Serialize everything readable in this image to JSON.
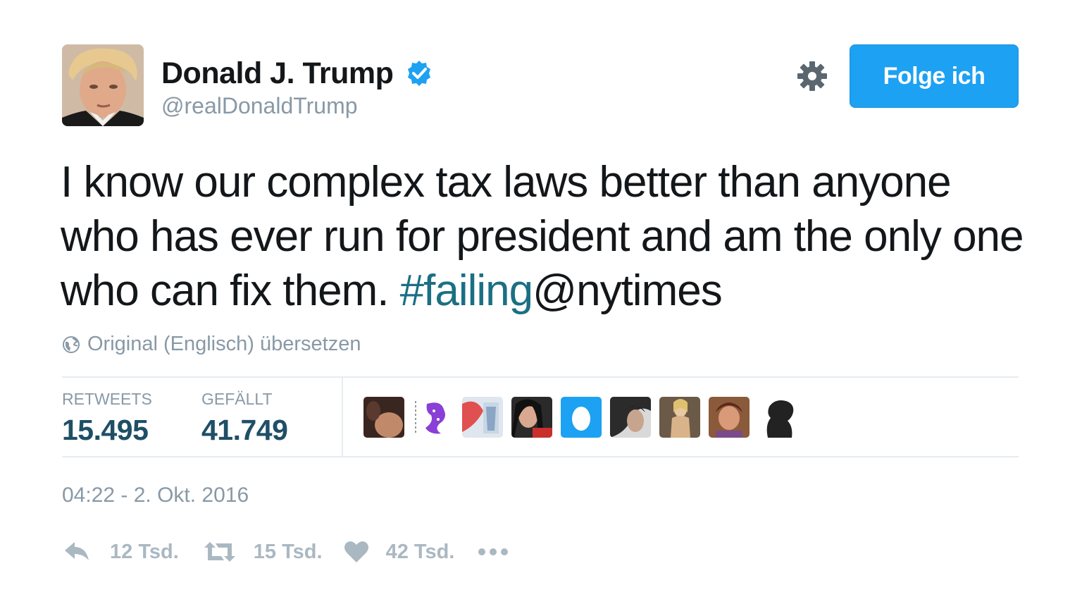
{
  "user": {
    "name": "Donald J. Trump",
    "handle": "@realDonaldTrump",
    "verified": true
  },
  "follow_button": {
    "label": "Folge ich"
  },
  "tweet": {
    "text_main": "I know our complex tax laws better than anyone who has ever run for president and am the only one who can fix them. ",
    "hashtag": "#failing",
    "mention": "@nytimes"
  },
  "translate": {
    "label": "Original (Englisch) übersetzen"
  },
  "stats": {
    "retweets_label": "RETWEETS",
    "retweets_value": "15.495",
    "likes_label": "GEFÄLLT",
    "likes_value": "41.749"
  },
  "timestamp": "04:22 - 2. Okt. 2016",
  "actions": {
    "reply_count": "12 Tsd.",
    "retweet_count": "15 Tsd.",
    "like_count": "42 Tsd."
  },
  "colors": {
    "accent": "#1da1f2",
    "hashtag": "#1b6f83",
    "muted": "#8899a6",
    "stat_value": "#1f4f66"
  }
}
